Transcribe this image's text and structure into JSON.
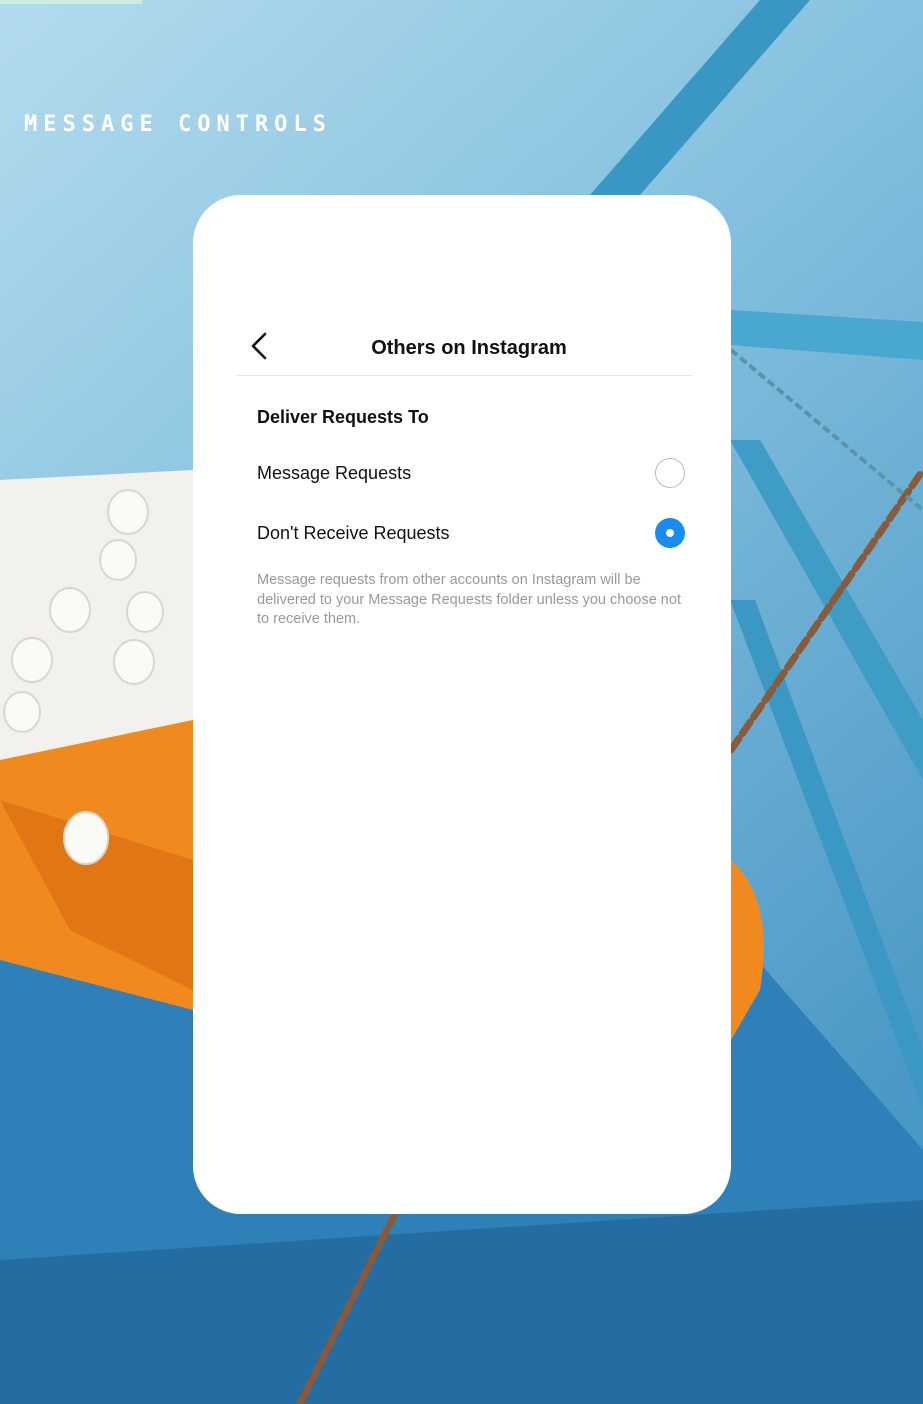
{
  "page": {
    "section_label": "MESSAGE CONTROLS"
  },
  "screen": {
    "title": "Others on Instagram",
    "back_icon": "chevron-left-icon",
    "section_heading": "Deliver Requests To",
    "options": [
      {
        "label": "Message Requests",
        "selected": false
      },
      {
        "label": "Don't Receive Requests",
        "selected": true
      }
    ],
    "help_text": "Message requests from other accounts on Instagram will be delivered to your Message Requests folder unless you choose not to receive them."
  },
  "colors": {
    "accent": "#1a8cf0",
    "sky": "#7fbcdb",
    "frame_teal": "#3f9ec8",
    "sign_orange": "#f08a1e",
    "chain": "#8a5a3a"
  }
}
